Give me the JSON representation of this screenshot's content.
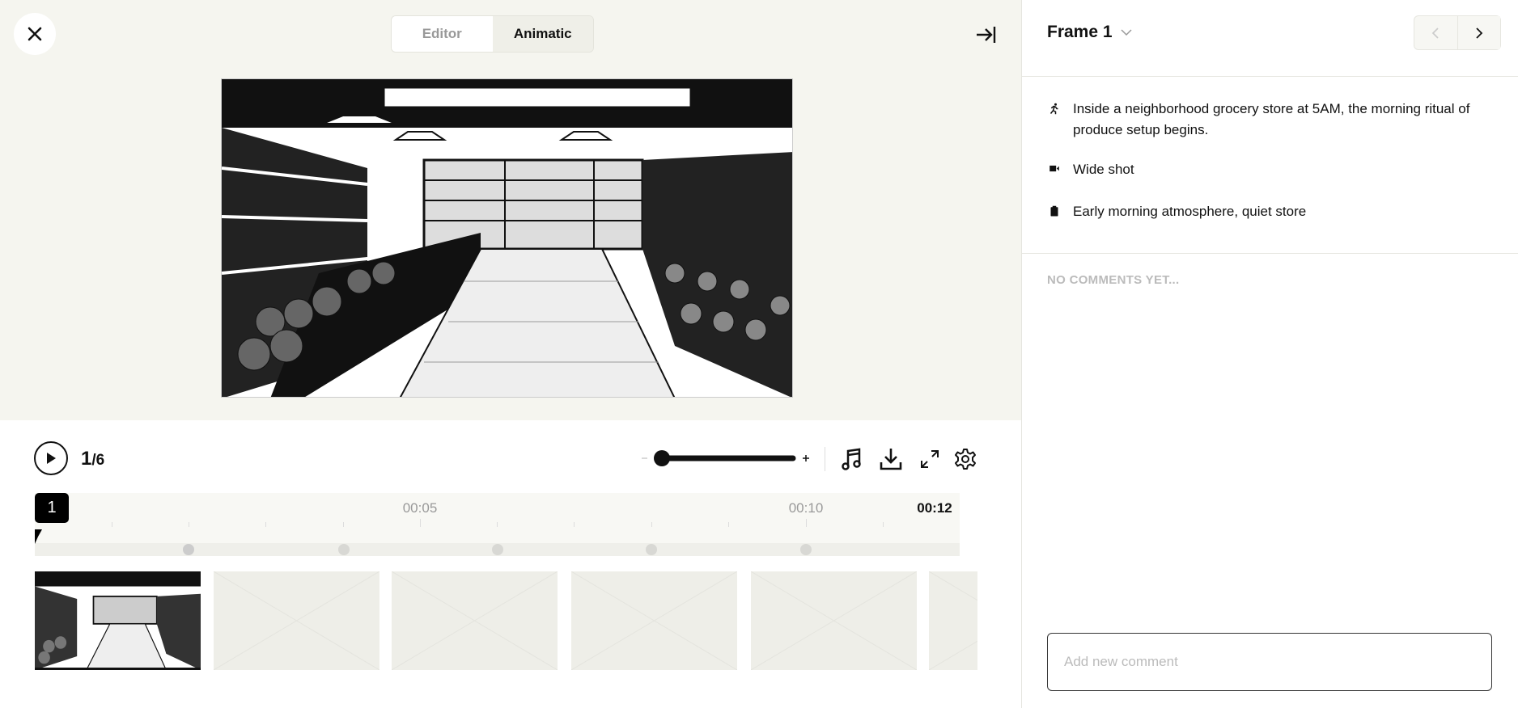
{
  "toolbar": {
    "tabs": [
      "Editor",
      "Animatic"
    ],
    "active_tab": "Animatic"
  },
  "player": {
    "current": "1",
    "total": "/6",
    "zoom_percent": 0
  },
  "timeline": {
    "current_frame_badge": "1",
    "labels": [
      "00:05",
      "00:10"
    ],
    "end_time": "00:12"
  },
  "panel": {
    "frame_title": "Frame 1",
    "details": [
      {
        "icon": "running-person-icon",
        "text": "Inside a neighborhood grocery store at 5AM, the morning ritual of produce setup begins."
      },
      {
        "icon": "video-camera-icon",
        "text": "Wide shot"
      },
      {
        "icon": "clipboard-icon",
        "text": "Early morning atmosphere, quiet store"
      }
    ],
    "no_comments": "NO COMMENTS YET...",
    "comment_placeholder": "Add new comment"
  }
}
